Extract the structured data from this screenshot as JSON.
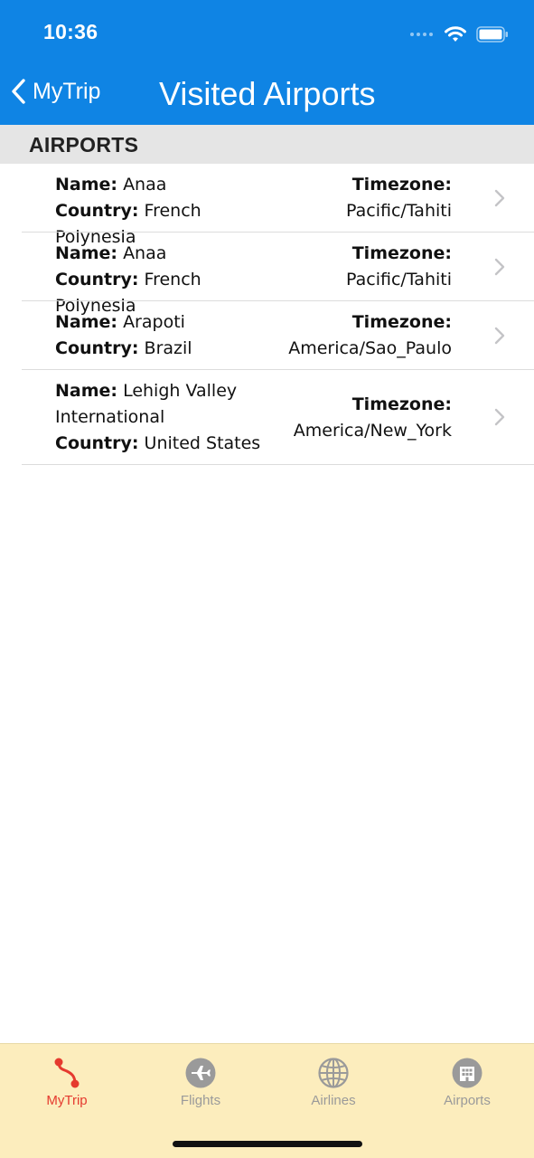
{
  "status_bar": {
    "time": "10:36"
  },
  "nav": {
    "back_label": "MyTrip",
    "title": "Visited Airports"
  },
  "section": {
    "title": "AIRPORTS"
  },
  "labels": {
    "name": "Name:",
    "country": "Country:",
    "timezone": "Timezone:"
  },
  "airports": [
    {
      "name": "Anaa",
      "country": "French Polynesia",
      "timezone": "Pacific/Tahiti"
    },
    {
      "name": "Anaa",
      "country": "French Polynesia",
      "timezone": "Pacific/Tahiti"
    },
    {
      "name": "Arapoti",
      "country": "Brazil",
      "timezone": "America/Sao_Paulo"
    },
    {
      "name": "Lehigh Valley International",
      "name_line1": "Lehigh Valley",
      "name_line2": "International",
      "country": "United States",
      "timezone": "America/New_York"
    }
  ],
  "tabs": [
    {
      "label": "MyTrip",
      "icon": "route-icon",
      "active": true
    },
    {
      "label": "Flights",
      "icon": "plane-icon",
      "active": false
    },
    {
      "label": "Airlines",
      "icon": "globe-icon",
      "active": false
    },
    {
      "label": "Airports",
      "icon": "building-icon",
      "active": false
    }
  ],
  "colors": {
    "nav_bar": "#0f84e4",
    "tab_bar": "#fcedbd",
    "active_tab": "#e53a2f",
    "inactive_tab": "#9a9a9a"
  }
}
